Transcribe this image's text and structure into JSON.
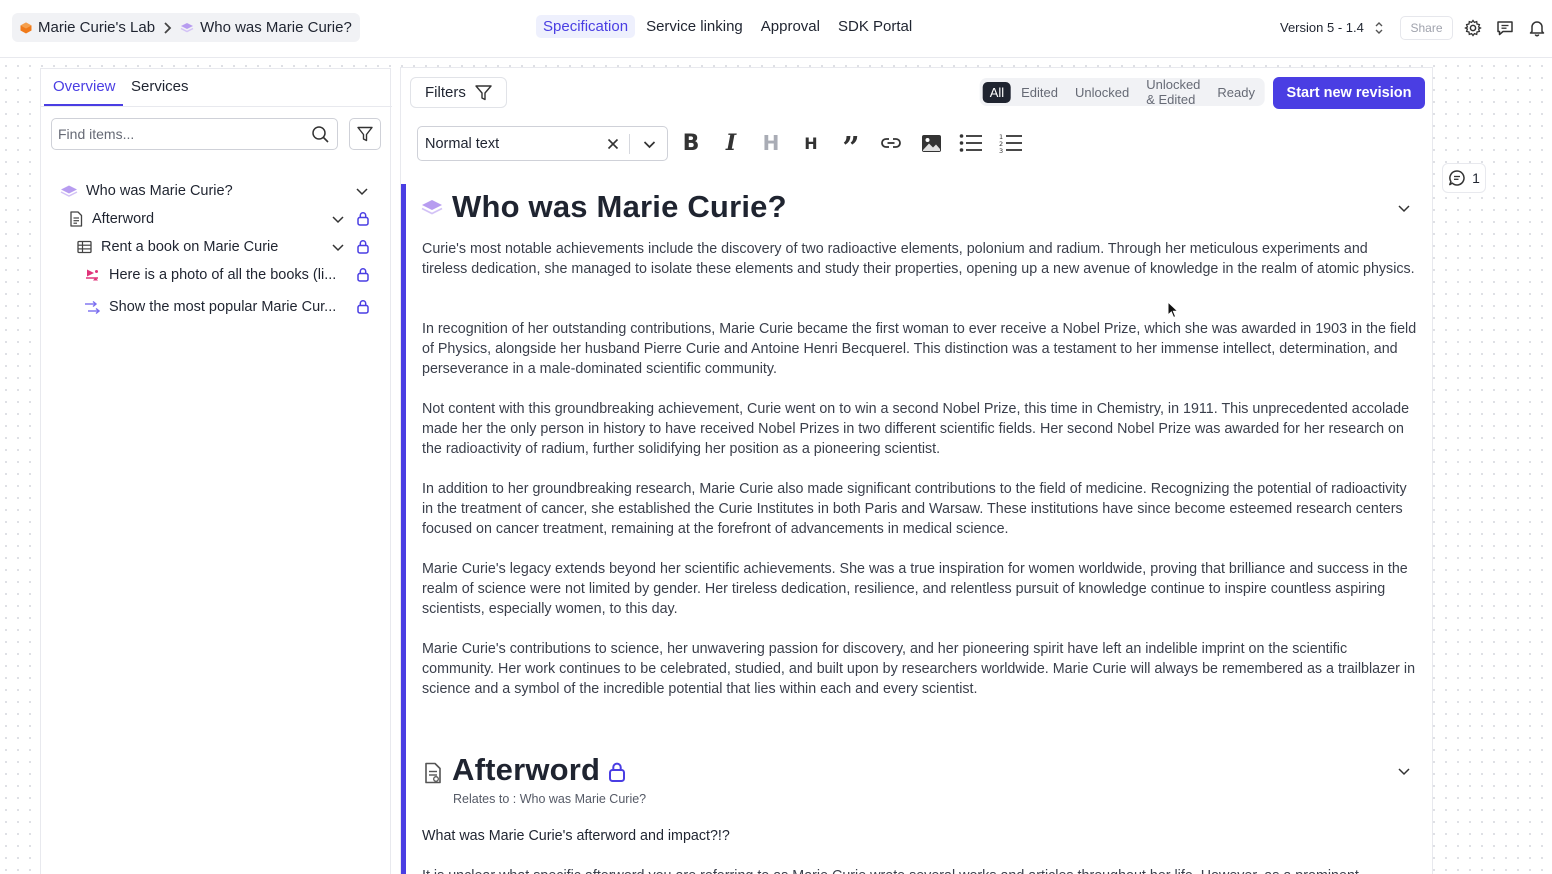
{
  "breadcrumb": {
    "project": "Marie Curie's Lab",
    "separator": ">",
    "page": "Who was Marie Curie?"
  },
  "top_nav": {
    "specification": "Specification",
    "service_linking": "Service linking",
    "approval": "Approval",
    "sdk_portal": "SDK Portal"
  },
  "version": "Version 5 - 1.4",
  "share_label": "Share",
  "sidebar": {
    "tabs": [
      "Overview",
      "Services"
    ],
    "search_placeholder": "Find items...",
    "tree": [
      {
        "label": "Who was Marie Curie?"
      },
      {
        "label": "Afterword"
      },
      {
        "label": "Rent a book on Marie Curie"
      },
      {
        "label": "Here is a photo of all the books (li..."
      },
      {
        "label": "Show the most popular Marie Cur..."
      }
    ]
  },
  "main": {
    "filters_label": "Filters",
    "segments": [
      "All",
      "Edited",
      "Unlocked",
      "Unlocked & Edited",
      "Ready"
    ],
    "start_revision_label": "Start new revision",
    "text_style": "Normal text",
    "toolbar_glyphs": {
      "bold": "B",
      "italic": "I",
      "heading1": "H",
      "heading2": "H",
      "quote": "”"
    },
    "section1": {
      "title": "Who was Marie Curie?",
      "paragraphs": [
        "Curie's most notable achievements include the discovery of two radioactive elements, polonium and radium. Through her meticulous experiments and tireless dedication, she managed to isolate these elements and study their properties, opening up a new avenue of knowledge in the realm of atomic physics.",
        "In recognition of her outstanding contributions, Marie Curie became the first woman to ever receive a Nobel Prize, which she was awarded in 1903 in the field of Physics, alongside her husband Pierre Curie and Antoine Henri Becquerel. This distinction was a testament to her immense intellect, determination, and perseverance in a male-dominated scientific community.",
        "Not content with this groundbreaking achievement, Curie went on to win a second Nobel Prize, this time in Chemistry, in 1911. This unprecedented accolade made her the only person in history to have received Nobel Prizes in two different scientific fields. Her second Nobel Prize was awarded for her research on the radioactivity of radium, further solidifying her position as a pioneering scientist.",
        "In addition to her groundbreaking research, Marie Curie also made significant contributions to the field of medicine. Recognizing the potential of radioactivity in the treatment of cancer, she established the Curie Institutes in both Paris and Warsaw. These institutions have since become esteemed research centers focused on cancer treatment, remaining at the forefront of advancements in medical science.",
        "Marie Curie's legacy extends beyond her scientific achievements. She was a true inspiration for women worldwide, proving that brilliance and success in the realm of science were not limited by gender. Her tireless dedication, resilience, and relentless pursuit of knowledge continue to inspire countless aspiring scientists, especially women, to this day.",
        "Marie Curie's contributions to science, her unwavering passion for discovery, and her pioneering spirit have left an indelible imprint on the scientific community. Her work continues to be celebrated, studied, and built upon by researchers worldwide. Marie Curie will always be remembered as a trailblazer in science and a symbol of the incredible potential that lies within each and every scientist."
      ]
    },
    "section2": {
      "title": "Afterword",
      "relates_to": "Relates to : Who was Marie Curie?",
      "question": "What was Marie Curie's afterword and impact?!?",
      "partial_line": "It is unclear what specific afterword you are referring to as Marie Curie wrote several works and articles throughout her life. However, as a prominent"
    }
  },
  "comments_count": "1",
  "colors": {
    "accent": "#4a3ee3",
    "brand_orange": "#f07a1a",
    "layer_purple": "#b79cf0",
    "photo_pink": "#e0337a"
  },
  "icons": [
    "chevron-right-icon",
    "layers-icon",
    "up-down-icon",
    "gear-icon",
    "chat-icon",
    "bell-icon",
    "search-icon",
    "filter-icon",
    "document-icon",
    "table-icon",
    "image-icon",
    "arrows-icon",
    "lock-icon",
    "chevron-down-icon",
    "close-icon",
    "bold-icon",
    "italic-icon",
    "heading-icon",
    "quote-icon",
    "link-icon",
    "bullet-list-icon",
    "numbered-list-icon",
    "comment-icon"
  ]
}
